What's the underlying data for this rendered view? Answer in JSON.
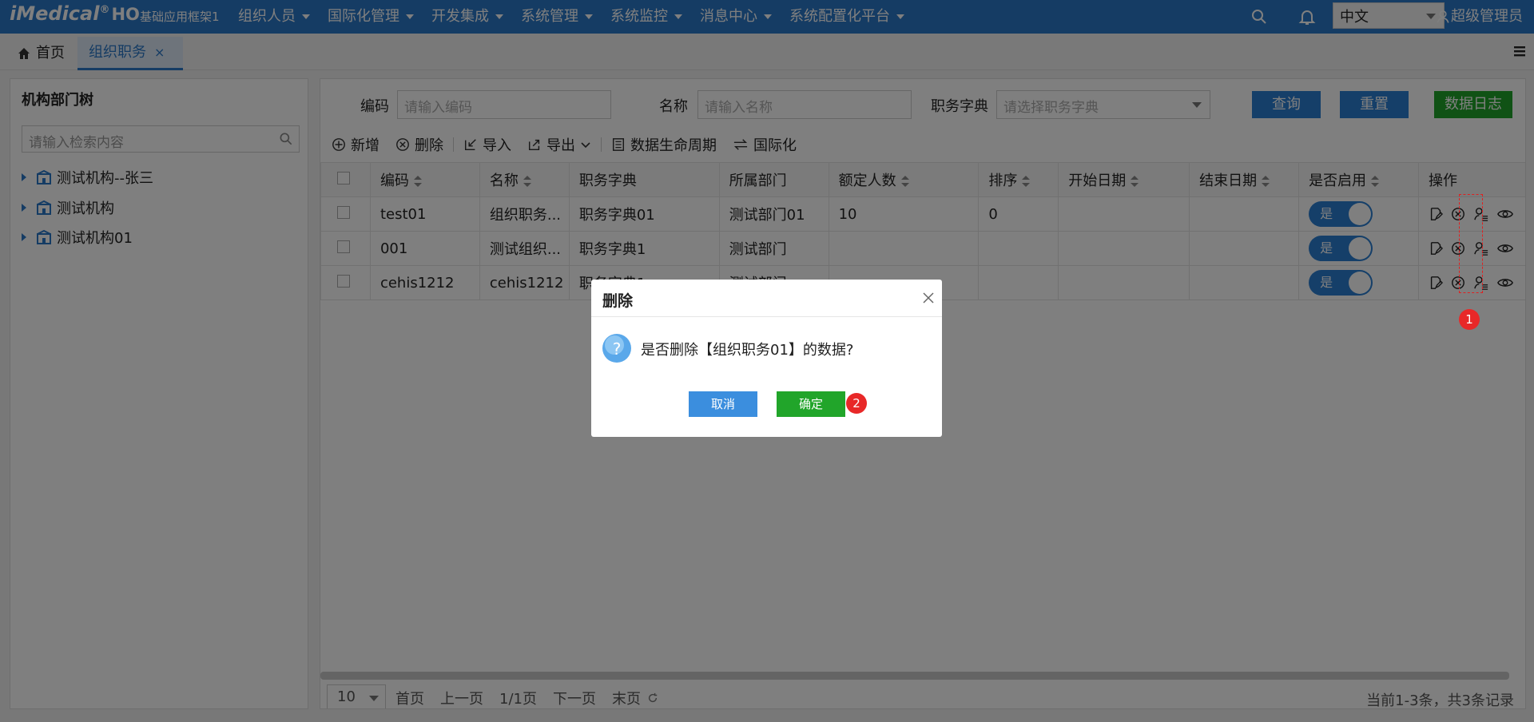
{
  "app": {
    "logo": "iMedical",
    "logo_reg": "®",
    "logo_suffix": "HO",
    "subtitle": "基础应用框架1"
  },
  "topnav": {
    "menus": [
      "组织人员",
      "国际化管理",
      "开发集成",
      "系统管理",
      "系统监控",
      "消息中心",
      "系统配置化平台"
    ],
    "language": "中文",
    "user": "超级管理员"
  },
  "tabs": {
    "home": "首页",
    "active": "组织职务",
    "close": "×"
  },
  "left": {
    "title": "机构部门树",
    "search_placeholder": "请输入检索内容",
    "tree": [
      "测试机构--张三",
      "测试机构",
      "测试机构01"
    ]
  },
  "filters": {
    "code_label": "编码",
    "code_placeholder": "请输入编码",
    "name_label": "名称",
    "name_placeholder": "请输入名称",
    "dict_label": "职务字典",
    "dict_placeholder": "请选择职务字典",
    "query": "查询",
    "reset": "重置",
    "log": "数据日志"
  },
  "toolbar": {
    "add": "新增",
    "delete": "删除",
    "import": "导入",
    "export": "导出",
    "lifecycle": "数据生命周期",
    "i18n": "国际化"
  },
  "table": {
    "headers": [
      "编码",
      "名称",
      "职务字典",
      "所属部门",
      "额定人数",
      "排序",
      "开始日期",
      "结束日期",
      "是否启用",
      "操作"
    ],
    "rows": [
      {
        "code": "test01",
        "name": "组织职务...",
        "dict": "职务字典01",
        "dept": "测试部门01",
        "quota": "10",
        "order": "0",
        "start": "",
        "end": "",
        "enabled": "是"
      },
      {
        "code": "001",
        "name": "测试组织...",
        "dict": "职务字典1",
        "dept": "测试部门",
        "quota": "",
        "order": "",
        "start": "",
        "end": "",
        "enabled": "是"
      },
      {
        "code": "cehis1212",
        "name": "cehis1212",
        "dict": "职务字典1",
        "dept": "测试部门",
        "quota": "",
        "order": "",
        "start": "",
        "end": "",
        "enabled": "是"
      }
    ]
  },
  "pager": {
    "size": "10",
    "first": "首页",
    "prev": "上一页",
    "pages": "1/1页",
    "next": "下一页",
    "last": "末页",
    "total": "当前1-3条，共3条记录"
  },
  "dialog": {
    "title": "删除",
    "message": "是否删除【组织职务01】的数据?",
    "cancel": "取消",
    "ok": "确定"
  },
  "badges": {
    "one": "1",
    "two": "2"
  },
  "colors": {
    "primary": "#2b78c8",
    "green": "#21a52a",
    "badge": "#e82828"
  }
}
